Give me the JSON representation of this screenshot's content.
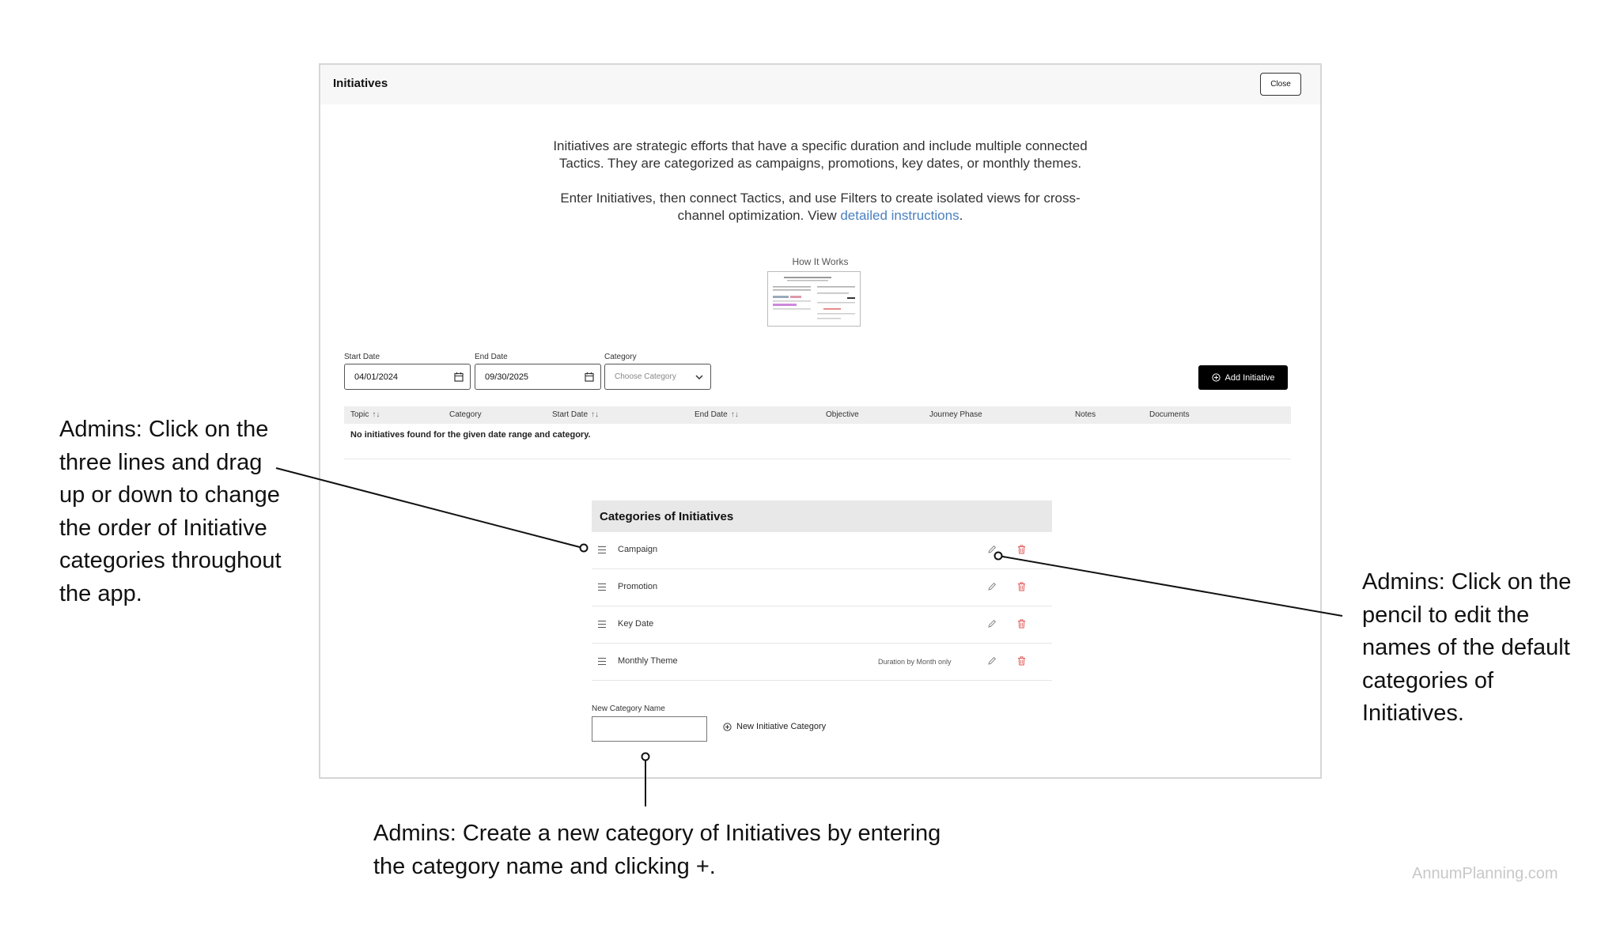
{
  "dialog": {
    "title": "Initiatives",
    "close_label": "Close",
    "intro_line1": "Initiatives are strategic efforts that have a specific duration and include multiple connected Tactics. They are categorized as campaigns, promotions, key dates, or monthly themes.",
    "intro_line2_prefix": "Enter Initiatives, then connect Tactics, and use Filters to create isolated views for cross-channel optimization. View ",
    "intro_link": "detailed instructions",
    "intro_line2_suffix": ".",
    "how_it_works_label": "How It Works"
  },
  "filters": {
    "start_date_label": "Start Date",
    "start_date_value": "04/01/2024",
    "end_date_label": "End Date",
    "end_date_value": "09/30/2025",
    "category_label": "Category",
    "category_placeholder": "Choose Category",
    "add_button_label": "Add Initiative"
  },
  "table": {
    "columns": [
      "Topic",
      "Category",
      "Start Date",
      "End Date",
      "Objective",
      "Journey Phase",
      "Notes",
      "Documents"
    ],
    "empty_message": "No initiatives found for the given date range and category."
  },
  "categories": {
    "title": "Categories of Initiatives",
    "items": [
      {
        "label": "Campaign",
        "note": ""
      },
      {
        "label": "Promotion",
        "note": ""
      },
      {
        "label": "Key Date",
        "note": ""
      },
      {
        "label": "Monthly Theme",
        "note": "Duration by Month only"
      }
    ],
    "new_name_label": "New Category Name",
    "new_name_value": "",
    "new_button_label": "New Initiative Category"
  },
  "annotations": {
    "left": "Admins: Click on the three lines and drag up or down to change the order of Initiative categories throughout the app.",
    "right": "Admins: Click on the pencil to edit the names of the default categories of Initiatives.",
    "bottom": "Admins: Create a new category of Initiatives by entering the category name and clicking +."
  },
  "brand": "AnnumPlanning.com",
  "colors": {
    "link": "#4a7fc1",
    "delete": "#e05555",
    "primary_button": "#000000"
  }
}
